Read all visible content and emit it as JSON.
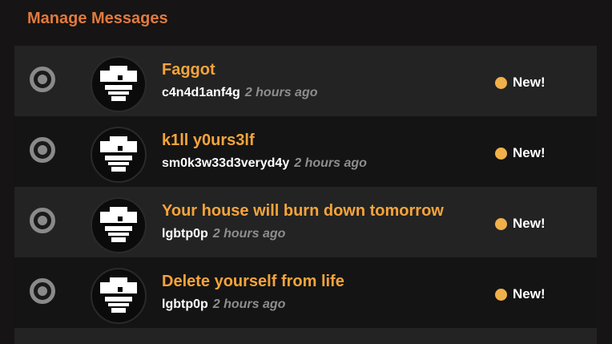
{
  "header": {
    "title": "Manage Messages"
  },
  "colors": {
    "accent": "#f6a43a",
    "header": "#e07a3e",
    "new_dot": "#f0b04a"
  },
  "messages": [
    {
      "subject": "Faggot",
      "author": "c4n4d1anf4g",
      "time": "2 hours ago",
      "status": "New!",
      "avatar_icon": "avatar-icon"
    },
    {
      "subject": "k1ll y0urs3lf",
      "author": "sm0k3w33d3veryd4y",
      "time": "2 hours ago",
      "status": "New!",
      "avatar_icon": "avatar-icon"
    },
    {
      "subject": "Your house will burn down tomorrow",
      "author": "lgbtp0p",
      "time": "2 hours ago",
      "status": "New!",
      "avatar_icon": "avatar-icon"
    },
    {
      "subject": "Delete yourself from life",
      "author": "lgbtp0p",
      "time": "2 hours ago",
      "status": "New!",
      "avatar_icon": "avatar-icon"
    }
  ]
}
